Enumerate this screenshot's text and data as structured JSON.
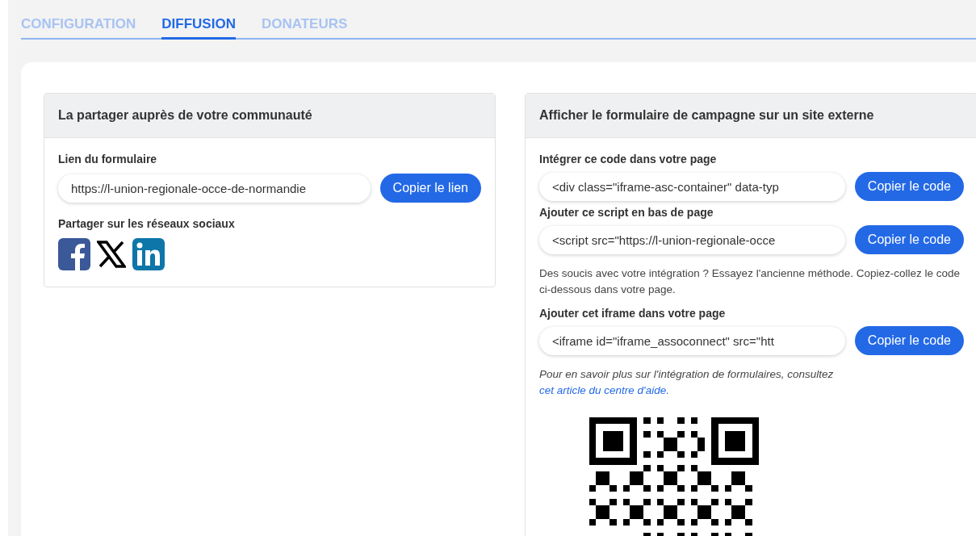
{
  "tabs": [
    {
      "label": "CONFIGURATION",
      "selected": false
    },
    {
      "label": "DIFFUSION",
      "selected": true
    },
    {
      "label": "DONATEURS",
      "selected": false
    }
  ],
  "share_panel": {
    "title": "La partager auprès de votre communauté",
    "link_label": "Lien du formulaire",
    "link_value": "https://l-union-regionale-occe-de-normandie",
    "copy_button": "Copier le lien",
    "social_label": "Partager sur les réseaux sociaux",
    "socials": [
      {
        "kind": "facebook"
      },
      {
        "kind": "x"
      },
      {
        "kind": "linkedin"
      }
    ]
  },
  "embed_panel": {
    "title": "Afficher le formulaire de campagne sur un site externe",
    "blocks": [
      {
        "kind": "field",
        "label": "Intégrer ce code dans votre page",
        "value": "<div class=\"iframe-asc-container\" data-typ",
        "button": "Copier le code"
      },
      {
        "kind": "field",
        "label": "Ajouter ce script en bas de page",
        "value": "<script src=\"https://l-union-regionale-occe",
        "button": "Copier le code"
      },
      {
        "kind": "note",
        "text": "Des soucis avec votre intégration ? Essayez l'ancienne méthode. Copiez-collez le code ci-dessous dans votre page."
      },
      {
        "kind": "field",
        "label": "Ajouter cet iframe dans votre page",
        "value": "<iframe id=\"iframe_assoconnect\" src=\"htt",
        "button": "Copier le code"
      }
    ],
    "help_text": "Pour en savoir plus sur l'intégration de formulaires, consultez",
    "help_link": "cet article du centre d'aide."
  }
}
